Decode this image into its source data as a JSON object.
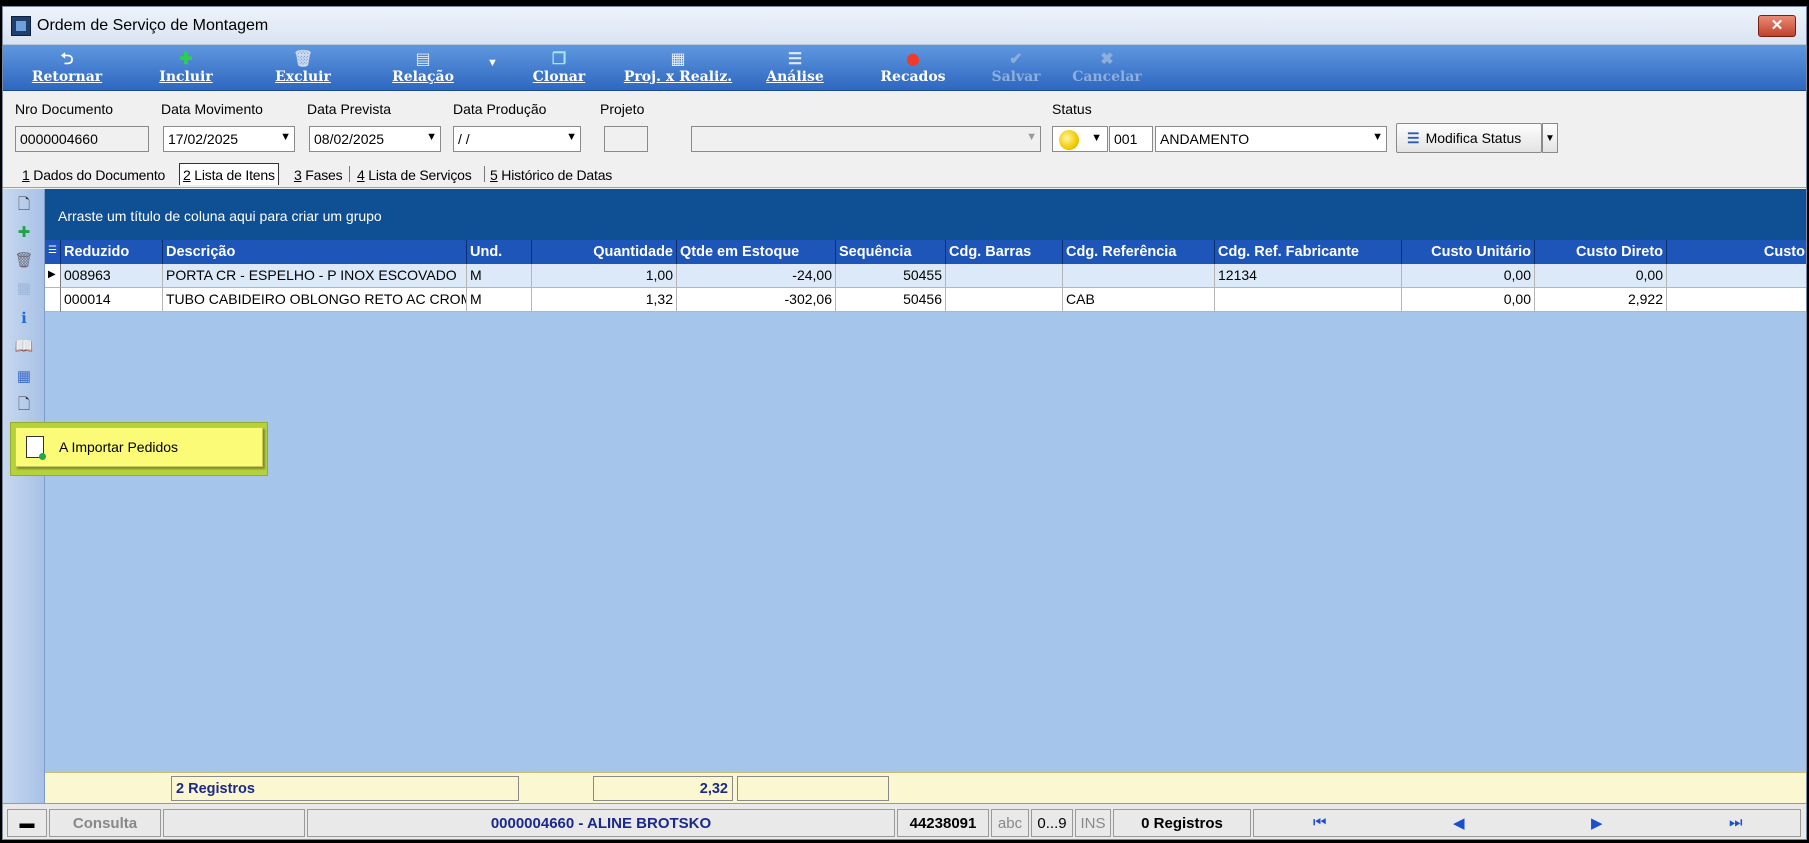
{
  "window": {
    "title": "Ordem de Serviço de Montagem",
    "close_label": "✕"
  },
  "toolbar": {
    "retornar": "Retornar",
    "incluir": "Incluir",
    "excluir": "Excluir",
    "relacao": "Relação",
    "clonar": "Clonar",
    "proj_realiz": "Proj. x Realiz.",
    "analise": "Análise",
    "recados": "Recados",
    "salvar": "Salvar",
    "cancelar": "Cancelar"
  },
  "header": {
    "nro_documento_label": "Nro Documento",
    "nro_documento": "0000004660",
    "data_movimento_label": "Data Movimento",
    "data_movimento": "17/02/2025",
    "data_prevista_label": "Data Prevista",
    "data_prevista": "08/02/2025",
    "data_producao_label": "Data Produção",
    "data_producao": " /  /",
    "projeto_label": "Projeto",
    "projeto": "",
    "projeto_desc": "",
    "status_label": "Status",
    "status_code": "001",
    "status_value": "ANDAMENTO",
    "modifica_status": "Modifica Status"
  },
  "tabs": [
    {
      "num": "1",
      "label": "Dados do Documento"
    },
    {
      "num": "2",
      "label": "Lista de Itens"
    },
    {
      "num": "3",
      "label": "Fases"
    },
    {
      "num": "4",
      "label": "Lista de Serviços"
    },
    {
      "num": "5",
      "label": "Histórico de Datas"
    }
  ],
  "grid": {
    "group_hint": "Arraste um título de coluna aqui para criar um grupo",
    "columns": [
      "Reduzido",
      "Descrição",
      "Und.",
      "Quantidade",
      "Qtde em Estoque",
      "Sequência",
      "Cdg. Barras",
      "Cdg. Referência",
      "Cdg. Ref. Fabricante",
      "Custo Unitário",
      "Custo Direto",
      "Custo"
    ],
    "rows": [
      {
        "reduzido": "008963",
        "descricao": "PORTA CR - ESPELHO - P INOX ESCOVADO",
        "und": "M",
        "quantidade": "1,00",
        "estoque": "-24,00",
        "sequencia": "50455",
        "barras": "",
        "referencia": "",
        "ref_fabricante": "12134",
        "custo_unitario": "0,00",
        "custo_direto": "0,00",
        "custo": ""
      },
      {
        "reduzido": "000014",
        "descricao": "TUBO CABIDEIRO OBLONGO RETO  AC CROMADO",
        "und": "M",
        "quantidade": "1,32",
        "estoque": "-302,06",
        "sequencia": "50456",
        "barras": "",
        "referencia": "CAB",
        "ref_fabricante": "",
        "custo_unitario": "0,00",
        "custo_direto": "2,922",
        "custo": ""
      }
    ],
    "footer": {
      "registros": "2 Registros",
      "quantidade_total": "2,32",
      "estoque_total": ""
    }
  },
  "popup": {
    "label": "A Importar Pedidos"
  },
  "statusbar": {
    "mode": "Consulta",
    "field2": "",
    "document_user": "0000004660 - ALINE BROTSKO",
    "code": "44238091",
    "abc": "abc",
    "num": "0...9",
    "ins": "INS",
    "registros": "0 Registros"
  }
}
